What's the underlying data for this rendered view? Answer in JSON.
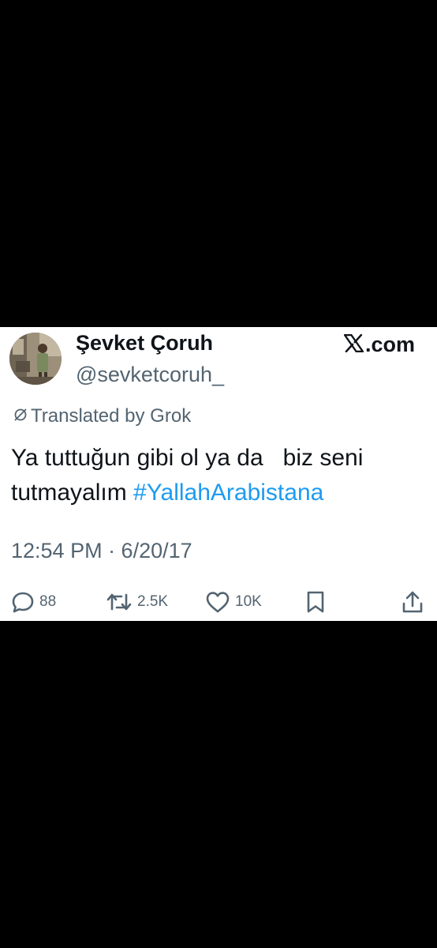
{
  "tweet": {
    "author_name": "Şevket Çoruh",
    "author_handle": "@sevketcoruh_",
    "brand_label": ".com",
    "translated_label": "Translated by Grok",
    "text_main": "Ya tuttuğun gibi ol ya da   biz seni tutmayalım ",
    "hashtag": "#YallahArabistana",
    "timestamp": "12:54 PM · 6/20/17"
  },
  "actions": {
    "replies": "88",
    "reposts": "2.5K",
    "likes": "10K"
  },
  "icons": {
    "brand": "x-logo-icon",
    "translated": "translate-icon",
    "reply": "reply-icon",
    "repost": "repost-icon",
    "like": "like-icon",
    "bookmark": "bookmark-icon",
    "share": "share-icon"
  },
  "colors": {
    "link": "#1d9bf0",
    "text": "#0f1419",
    "secondary": "#536471",
    "background": "#000000",
    "card": "#ffffff"
  }
}
